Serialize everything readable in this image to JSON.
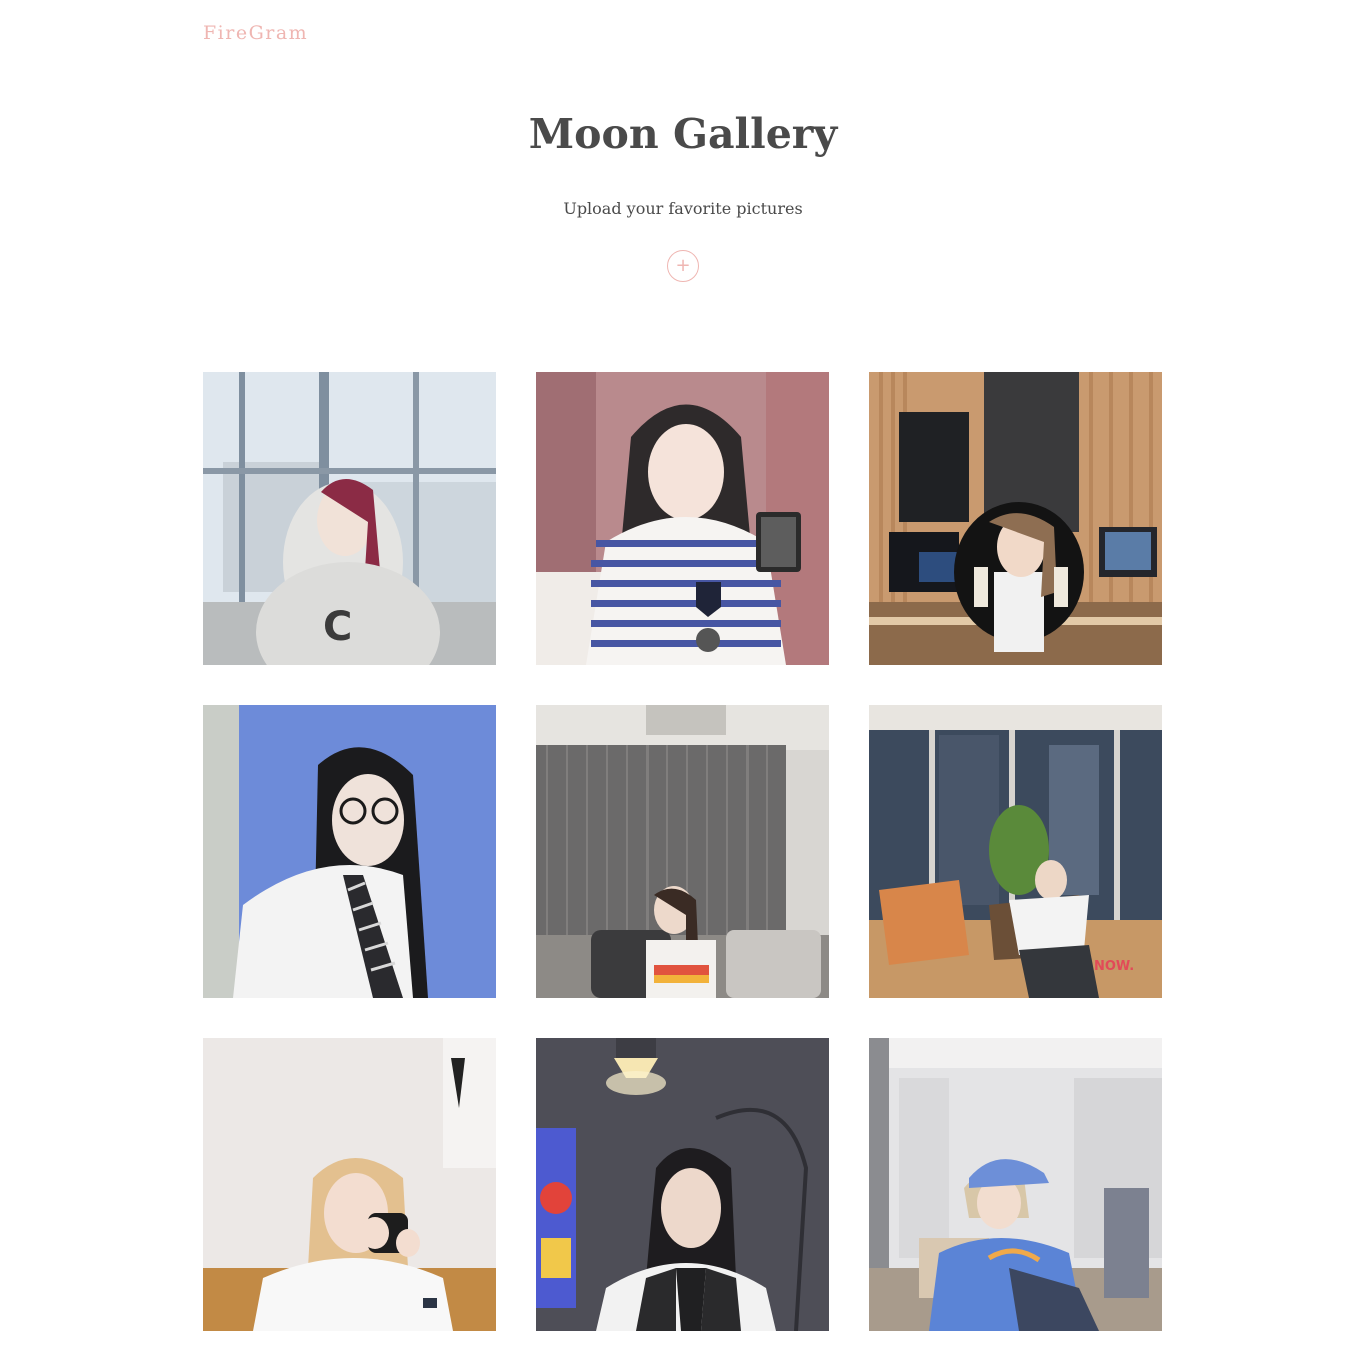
{
  "header": {
    "brand": "FireGram"
  },
  "hero": {
    "title": "Moon Gallery",
    "subtitle": "Upload your favorite pictures",
    "upload_icon": "plus-icon",
    "upload_symbol": "+"
  },
  "colors": {
    "accent": "#efb6b2",
    "text": "#4a4a4a"
  },
  "gallery": {
    "photos": [
      {
        "scene": "window-hoodie"
      },
      {
        "scene": "striped-shirt-microphone"
      },
      {
        "scene": "studio-monitors-jacket"
      },
      {
        "scene": "glasses-necktie-blue-wall"
      },
      {
        "scene": "office-partition-sofa"
      },
      {
        "scene": "night-lounge-chairs"
      },
      {
        "scene": "mug-blonde-hair"
      },
      {
        "scene": "lamp-dark-room"
      },
      {
        "scene": "blue-cap-office"
      }
    ]
  }
}
